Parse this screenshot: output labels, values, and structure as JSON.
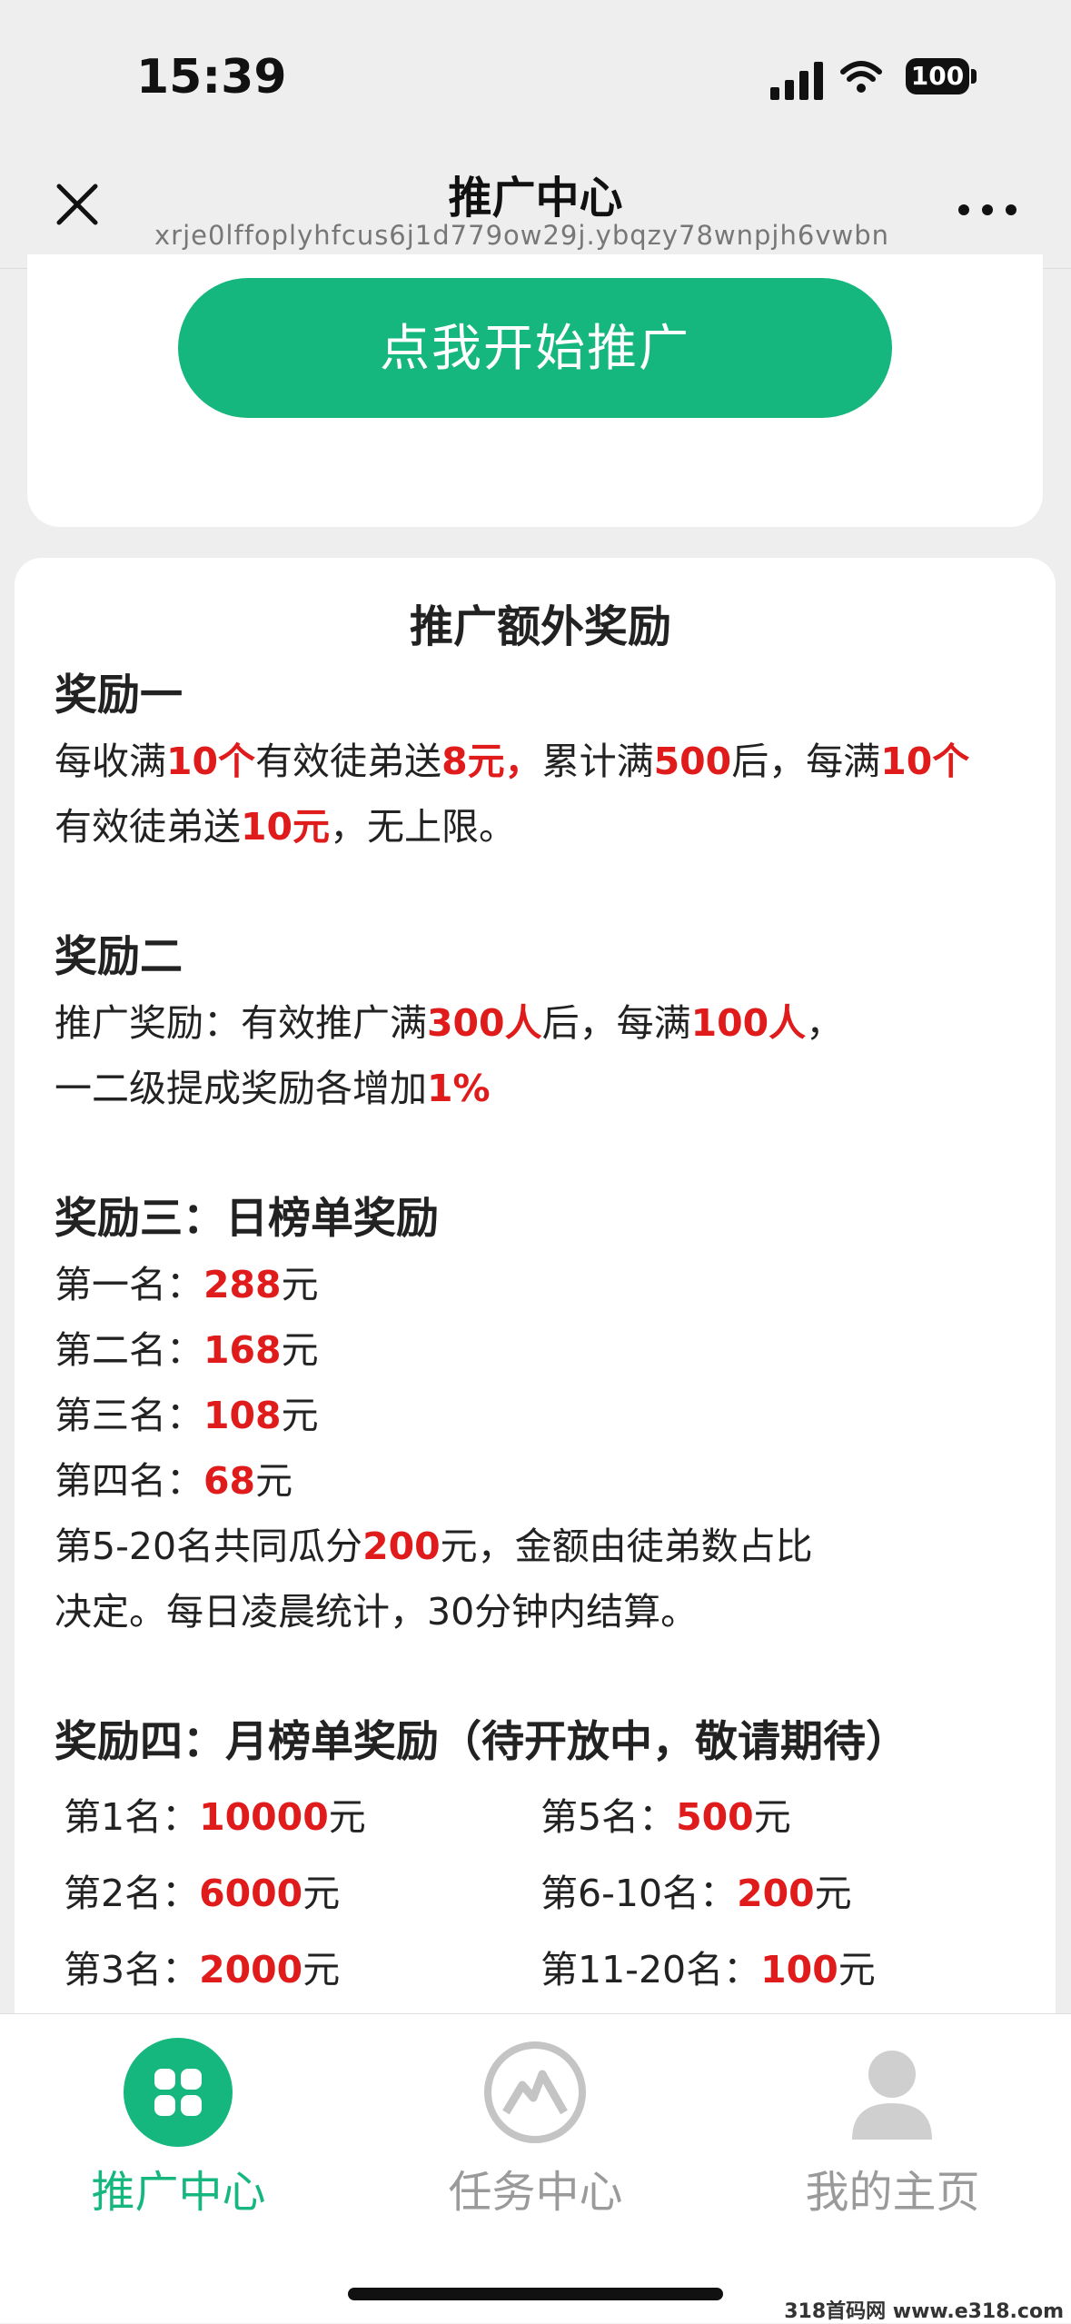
{
  "status_bar": {
    "time": "15:39",
    "battery": "100"
  },
  "nav": {
    "title": "推广中心",
    "url": "xrje0lffoplyhfcus6j1d779ow29j.ybqzy78wnpjh6vwbn",
    "close_icon": "close-icon",
    "more_icon": "more-icon"
  },
  "cta": {
    "label": "点我开始推广",
    "color": "#16b77e"
  },
  "rewards": {
    "heading": "推广额外奖励",
    "s1": {
      "title": "奖励一",
      "t1": "每收满",
      "h1": "10个",
      "t2": "有效徒弟送",
      "h2": "8元，",
      "t3": "累计满",
      "h3": "500",
      "t4": "后，每满",
      "h4": "10个",
      "t5": "有效徒弟送",
      "h5": "10元",
      "t6": "，无上限。"
    },
    "s2": {
      "title": "奖励二",
      "t1": "推广奖励：有效推广满",
      "h1": "300人",
      "t2": "后，每满",
      "h2": "100人",
      "t3": "，",
      "t4": "一二级提成奖励各增加",
      "h3": "1%"
    },
    "s3": {
      "title": "奖励三：日榜单奖励",
      "ranks": [
        {
          "label": "第一名：",
          "amount": "288",
          "unit": "元"
        },
        {
          "label": "第二名：",
          "amount": "168",
          "unit": "元"
        },
        {
          "label": "第三名：",
          "amount": "108",
          "unit": "元"
        },
        {
          "label": "第四名：",
          "amount": "68",
          "unit": "元"
        }
      ],
      "t1": "第5-20名共同瓜分",
      "h1": "200",
      "t2": "元，金额由徒弟数占比",
      "t3": "决定。每日凌晨统计，30分钟内结算。"
    },
    "s4": {
      "title": "奖励四：月榜单奖励（待开放中，敬请期待）",
      "rows": [
        {
          "l1": "第1名：",
          "a1": "10000",
          "u1": "元",
          "l2": "第5名：",
          "a2": "500",
          "u2": "元"
        },
        {
          "l1": "第2名：",
          "a1": "6000",
          "u1": "元",
          "l2": "第6-10名：",
          "a2": "200",
          "u2": "元"
        },
        {
          "l1": "第3名：",
          "a1": "2000",
          "u1": "元",
          "l2": "第11-20名：",
          "a2": "100",
          "u2": "元"
        }
      ]
    },
    "highlight_color": "#e01b1b"
  },
  "tabs": [
    {
      "label": "推广中心",
      "icon": "grid-icon",
      "active": true
    },
    {
      "label": "任务中心",
      "icon": "mountain-icon",
      "active": false
    },
    {
      "label": "我的主页",
      "icon": "user-icon",
      "active": false
    }
  ],
  "watermark": "318首码网 www.e318.com"
}
